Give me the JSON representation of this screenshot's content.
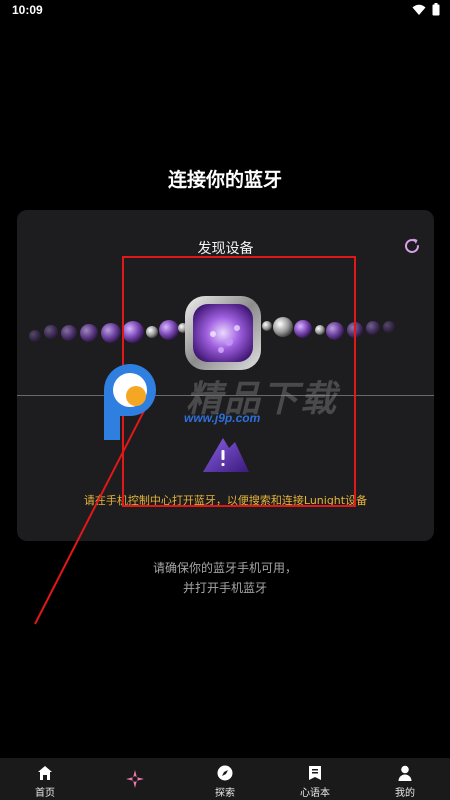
{
  "status": {
    "time": "10:09"
  },
  "page": {
    "title": "连接你的蓝牙"
  },
  "card": {
    "title": "发现设备",
    "hint": "请在手机控制中心打开蓝牙，以便搜索和连接Lunight设备"
  },
  "footer": {
    "line1": "请确保你的蓝牙手机可用，",
    "line2": "并打开手机蓝牙"
  },
  "watermark": {
    "text": "精品下载",
    "url": "www.j9p.com"
  },
  "nav": {
    "items": [
      {
        "label": "首页",
        "icon": "home-icon"
      },
      {
        "label": "",
        "icon": "star-compass-icon"
      },
      {
        "label": "探索",
        "icon": "compass-icon"
      },
      {
        "label": "心语本",
        "icon": "notebook-icon"
      },
      {
        "label": "我的",
        "icon": "profile-icon"
      }
    ]
  },
  "colors": {
    "hint": "#e7b43a",
    "highlight": "#e01818",
    "refresh": "#d9a0e8",
    "warning": "#6a3fc8"
  }
}
